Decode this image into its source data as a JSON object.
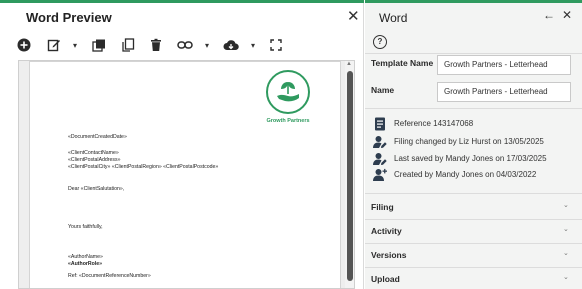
{
  "preview": {
    "title": "Word Preview",
    "close_glyph": "✕",
    "toolbar": {
      "icons": [
        "add-circle-icon",
        "edit-icon",
        "library-icon",
        "copy-icon",
        "delete-icon",
        "link-icon",
        "cloud-download-icon",
        "fullscreen-icon"
      ],
      "caret_glyph": "▾"
    },
    "document": {
      "logo_caption": "Growth Partners",
      "date_field": "«DocumentCreatedDate»",
      "contact_name": "«ClientContactName»",
      "postal_address": "«ClientPostalAddress»",
      "postal_city_line": "«ClientPostalCity» «ClientPostalRegion» «ClientPostalPostcode»",
      "salutation": "Dear «ClientSalutation»,",
      "closing": "Yours faithfully,",
      "author_name": "«AuthorName»",
      "author_role": "«AuthorRole»",
      "reference": "Ref: «DocumentReferenceNumber»"
    },
    "scroll_up_glyph": "▲"
  },
  "panel": {
    "title": "Word",
    "back_glyph": "←",
    "close_glyph": "✕",
    "help_glyph": "?",
    "template_name_label": "Template Name",
    "template_name_value": "Growth Partners - Letterhead",
    "name_label": "Name",
    "name_value": "Growth Partners - Letterhead",
    "info": [
      {
        "icon": "document-icon",
        "text": "Reference 143147068"
      },
      {
        "icon": "user-edit-icon",
        "text": "Filing changed by Liz Hurst on 13/05/2025"
      },
      {
        "icon": "user-edit-icon",
        "text": "Last saved by Mandy Jones on 17/03/2025"
      },
      {
        "icon": "user-add-icon",
        "text": "Created by Mandy Jones on 04/03/2022"
      }
    ],
    "sections": [
      "Filing",
      "Activity",
      "Versions",
      "Upload"
    ],
    "section_chevron_glyph": "⌄"
  },
  "colors": {
    "accent": "#2f9a5f",
    "panel_bg": "#f3f4f3"
  }
}
